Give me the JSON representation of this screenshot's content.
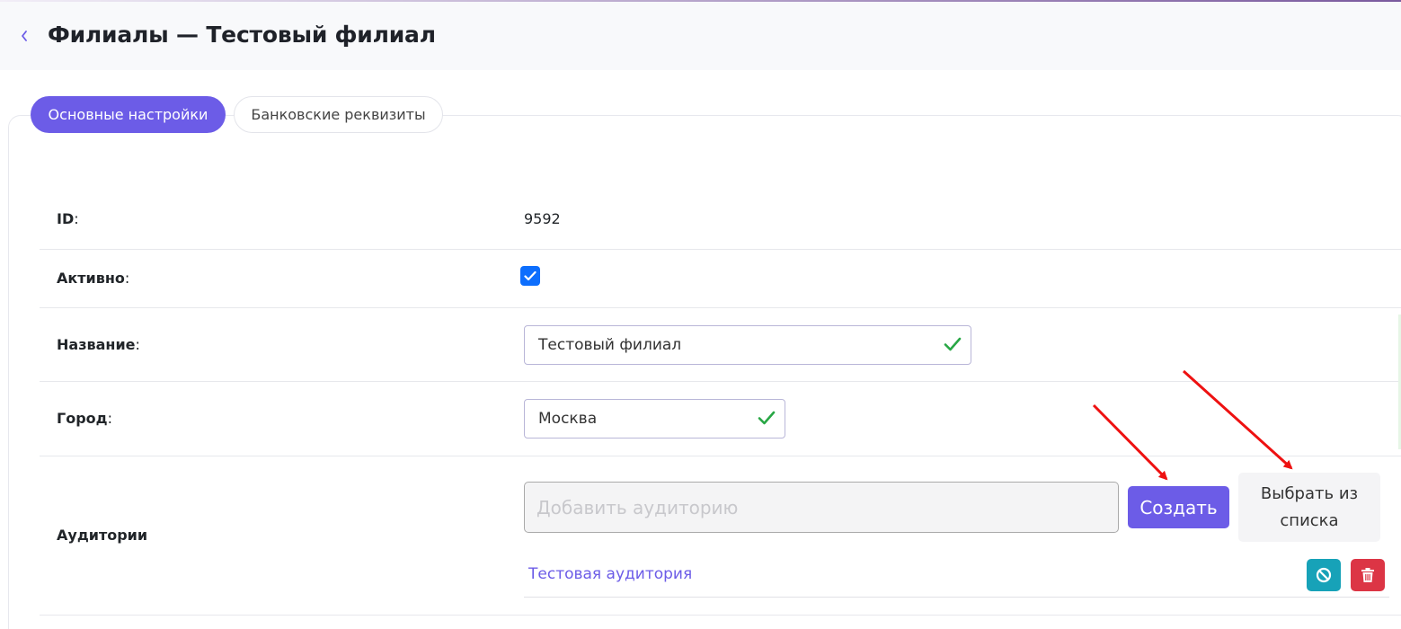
{
  "header": {
    "title": "Филиалы — Тестовый филиал"
  },
  "tabs": [
    {
      "label": "Основные настройки",
      "active": true
    },
    {
      "label": "Банковские реквизиты",
      "active": false
    }
  ],
  "fields": {
    "id": {
      "label": "ID",
      "value": "9592"
    },
    "active": {
      "label": "Активно",
      "checked": true
    },
    "name": {
      "label": "Название",
      "value": "Тестовый филиал"
    },
    "city": {
      "label": "Город",
      "value": "Москва"
    },
    "auditoriums": {
      "label": "Аудитории",
      "placeholder": "Добавить аудиторию",
      "create_label": "Создать",
      "select_label_line1": "Выбрать из",
      "select_label_line2": "списка",
      "items": [
        {
          "name": "Тестовая аудитория"
        }
      ]
    }
  },
  "colors": {
    "accent": "#6c5ce7",
    "checkbox": "#0d6efd",
    "valid": "#28a745",
    "info": "#17a2b8",
    "danger": "#dc3545",
    "annotation_arrow": "#ee1111"
  },
  "icons": {
    "back": "chevron-left-icon",
    "valid": "check-icon",
    "disable": "ban-icon",
    "delete": "trash-icon"
  }
}
